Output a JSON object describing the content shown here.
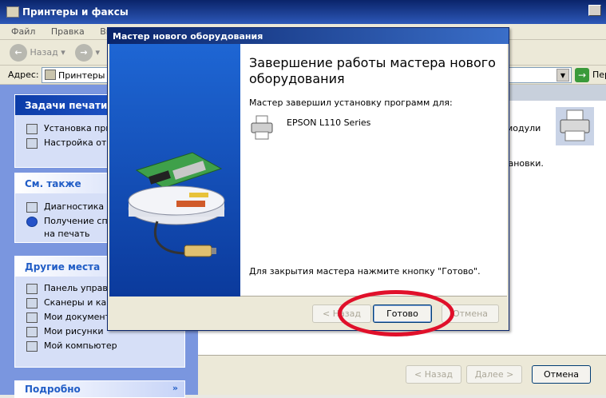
{
  "window": {
    "title": "Принтеры и факсы",
    "menu": [
      "Файл",
      "Правка",
      "Вид"
    ],
    "back_label": "Назад",
    "address_label": "Адрес:",
    "address_value": "Принтеры и",
    "go_label": "Пер"
  },
  "sidebar": {
    "print_tasks": {
      "title": "Задачи печати",
      "items": [
        "Установка прин",
        "Настройка отпр"
      ]
    },
    "see_also": {
      "title": "См. также",
      "items": [
        "Диагностика пе",
        "Получение спра",
        "на печать"
      ]
    },
    "other_places": {
      "title": "Другие места",
      "items": [
        "Панель управле",
        "Сканеры и каме",
        "Мои документы",
        "Мои рисунки",
        "Мой компьютер"
      ]
    },
    "details": {
      "title": "Подробно",
      "chevron": "»"
    }
  },
  "content": {
    "text1": "модули",
    "text2": "становки."
  },
  "background_wizard": {
    "back": "< Назад",
    "next": "Далее >",
    "cancel": "Отмена"
  },
  "dialog": {
    "title": "Мастер нового оборудования",
    "heading": "Завершение работы мастера нового оборудования",
    "installed_text": "Мастер завершил установку программ для:",
    "device_name": "EPSON L110 Series",
    "close_hint": "Для закрытия мастера нажмите кнопку \"Готово\".",
    "buttons": {
      "back": "< Назад",
      "finish": "Готово",
      "cancel": "Отмена"
    }
  },
  "colors": {
    "titlebar": "#0a246a",
    "sidebar_bg": "#7a96df",
    "annotation": "#e0102a"
  }
}
